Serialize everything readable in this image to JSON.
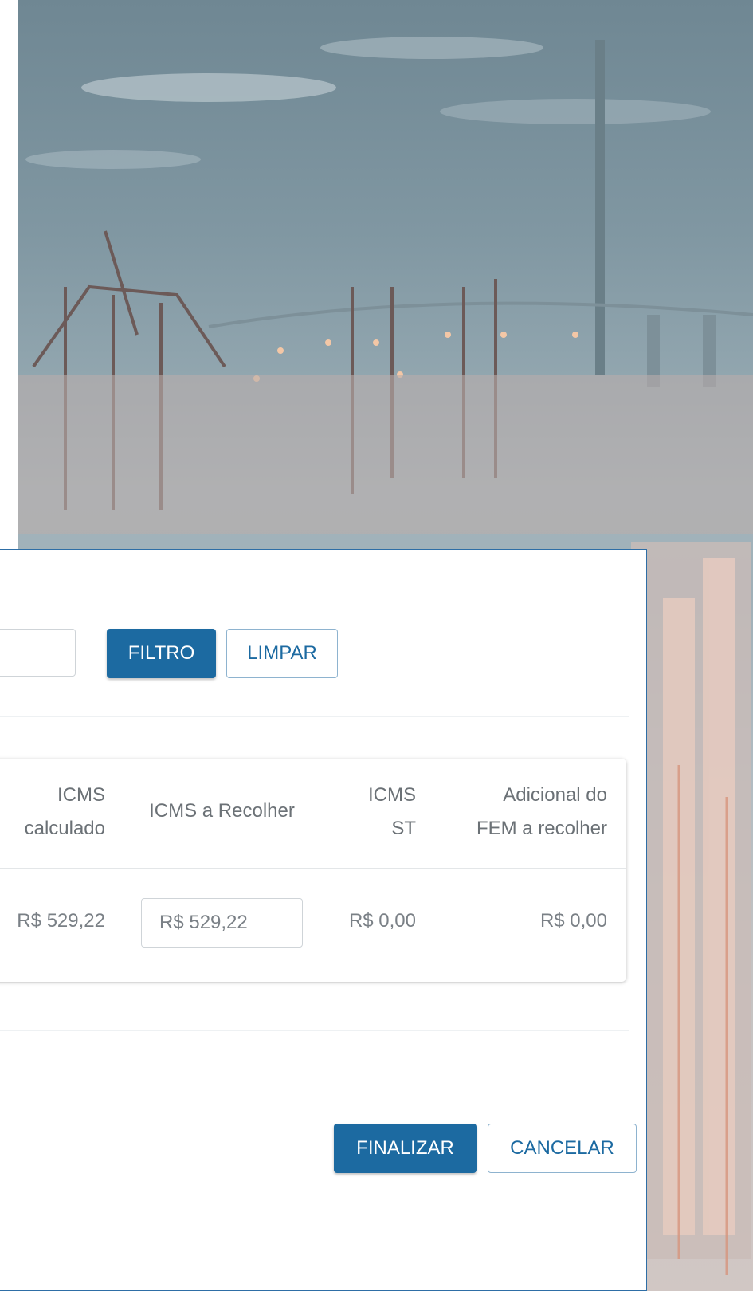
{
  "filter": {
    "filter_button": "FILTRO",
    "clear_button": "LIMPAR"
  },
  "table": {
    "headers": [
      {
        "line1": "ICMS",
        "line2": "calculado"
      },
      {
        "line1": "ICMS a Recolher",
        "line2": ""
      },
      {
        "line1": "ICMS",
        "line2": "ST"
      },
      {
        "line1": "Adicional do",
        "line2": "FEM a recolher"
      }
    ],
    "row": {
      "icms_calculado": "R$ 529,22",
      "icms_a_recolher": "R$ 529,22",
      "icms_st": "R$ 0,00",
      "adicional_fem": "R$ 0,00"
    }
  },
  "actions": {
    "finalize_button": "FINALIZAR",
    "cancel_button": "CANCELAR"
  },
  "colors": {
    "primary": "#1c6aa1",
    "modal_border": "#2e6ea6"
  }
}
